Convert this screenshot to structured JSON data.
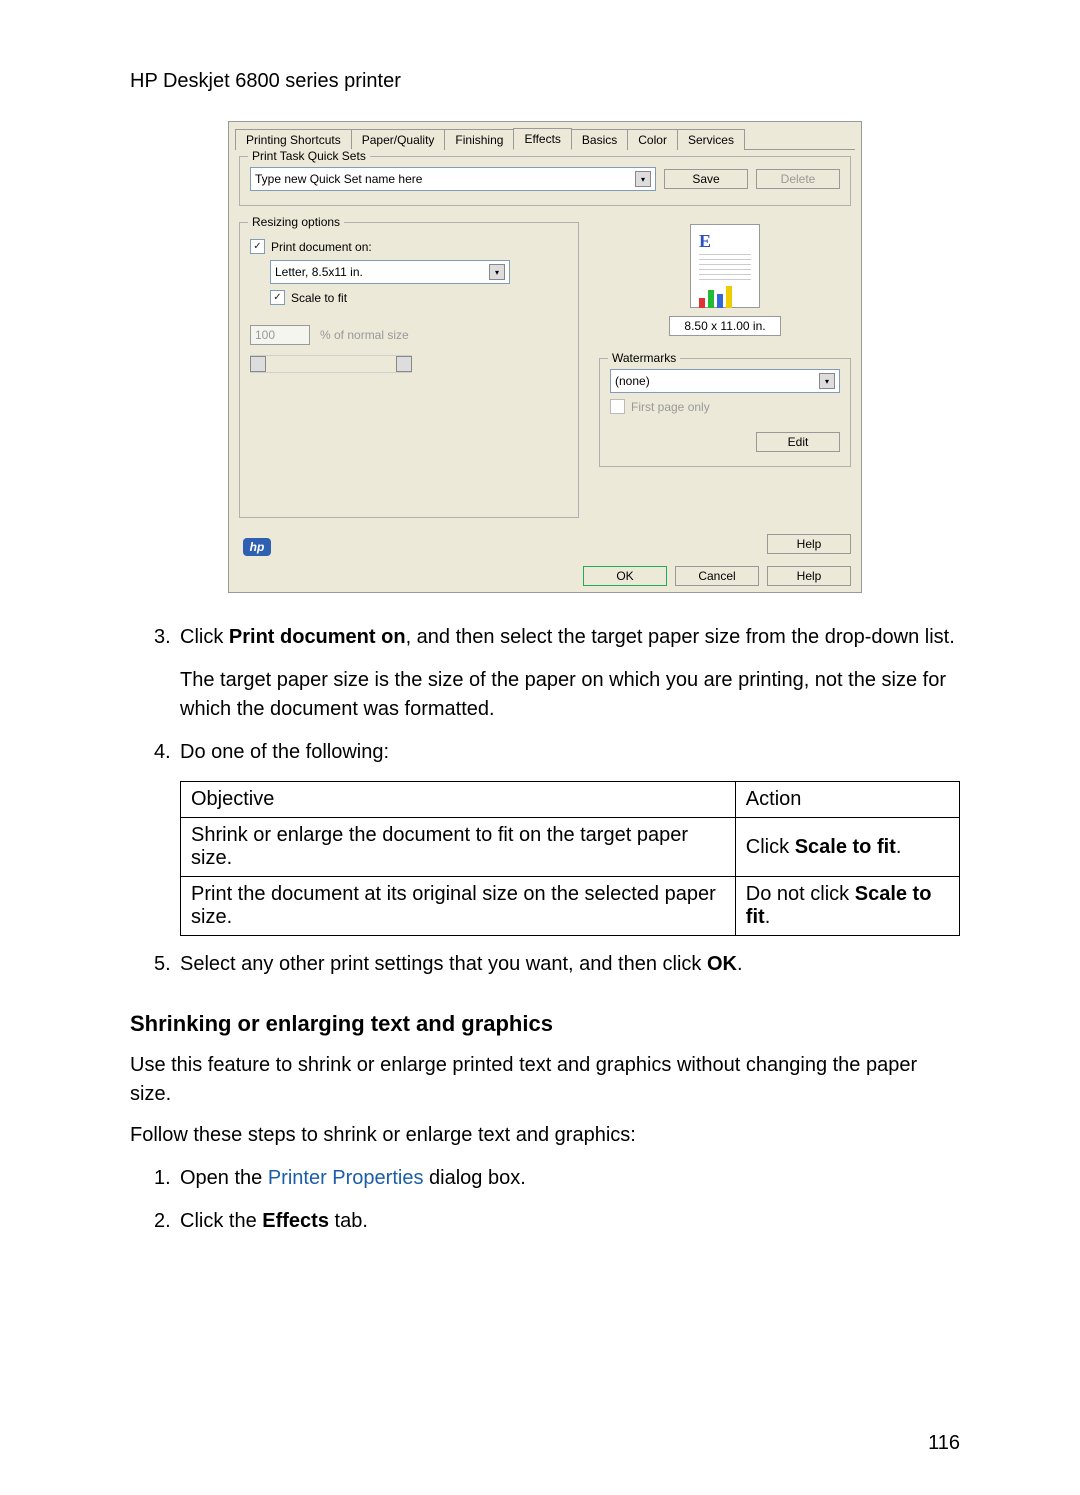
{
  "header": {
    "title": "HP Deskjet 6800 series printer"
  },
  "dialog": {
    "tabs": [
      "Printing Shortcuts",
      "Paper/Quality",
      "Finishing",
      "Effects",
      "Basics",
      "Color",
      "Services"
    ],
    "active_tab_index": 3,
    "quicksets": {
      "legend": "Print Task Quick Sets",
      "placeholder": "Type new Quick Set name here",
      "save": "Save",
      "delete": "Delete"
    },
    "resizing": {
      "legend": "Resizing options",
      "print_doc_on_label": "Print document on:",
      "print_doc_on_checked": true,
      "paper_size_value": "Letter, 8.5x11 in.",
      "scale_to_fit_label": "Scale to fit",
      "scale_to_fit_checked": true,
      "percent_value": "100",
      "percent_label": "% of normal size"
    },
    "preview": {
      "size_text": "8.50 x 11.00 in."
    },
    "watermarks": {
      "legend": "Watermarks",
      "value": "(none)",
      "first_page_label": "First page only",
      "first_page_checked": false,
      "edit": "Edit"
    },
    "help_top": "Help",
    "footer": {
      "ok": "OK",
      "cancel": "Cancel",
      "help": "Help"
    }
  },
  "steps": {
    "s3a": "Click ",
    "s3b": "Print document on",
    "s3c": ", and then select the target paper size from the drop-down list.",
    "s3_para2": "The target paper size is the size of the paper on which you are printing, not the size for which the document was formatted.",
    "s4": "Do one of the following:",
    "table": {
      "h1": "Objective",
      "h2": "Action",
      "r1c1": "Shrink or enlarge the document to fit on the target paper size.",
      "r1c2a": "Click ",
      "r1c2b": "Scale to fit",
      "r2c1": "Print the document at its original size on the selected paper size.",
      "r2c2a": "Do not click ",
      "r2c2b": "Scale to fit"
    },
    "s5a": "Select any other print settings that you want, and then click ",
    "s5b": "OK"
  },
  "section2": {
    "heading": "Shrinking or enlarging text and graphics",
    "p1": "Use this feature to shrink or enlarge printed text and graphics without changing the paper size.",
    "p2": "Follow these steps to shrink or enlarge text and graphics:",
    "li1a": "Open the ",
    "li1b": "Printer Properties",
    "li1c": " dialog box.",
    "li2a": "Click the ",
    "li2b": "Effects",
    "li2c": " tab."
  },
  "page_number": "116"
}
